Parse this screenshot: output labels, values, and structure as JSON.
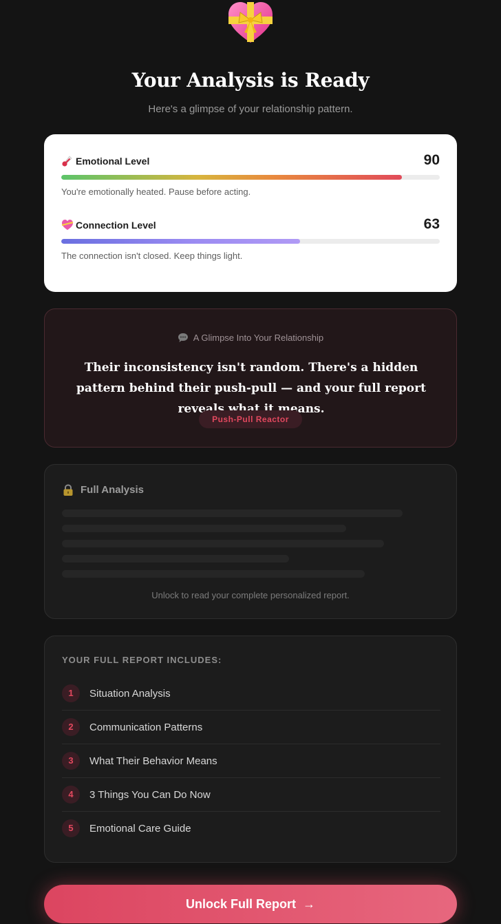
{
  "hero": {
    "icon": "heart-with-ribbon-icon",
    "title": "Your Analysis is Ready",
    "subtitle": "Here's a glimpse of your relationship pattern."
  },
  "meters": [
    {
      "icon": "thermometer-icon",
      "label": "Emotional Level",
      "value": "90",
      "fill_percent": 90,
      "description": "You're emotionally heated. Pause before acting."
    },
    {
      "icon": "heart-icon",
      "label": "Connection Level",
      "value": "63",
      "fill_percent": 63,
      "description": "The connection isn't closed. Keep things light."
    }
  ],
  "glimpse": {
    "icon": "speech-bubble-icon",
    "heading": "A Glimpse Into Your Relationship",
    "quote": "Their inconsistency isn't random. There's a hidden pattern behind their push-pull — and your full report reveals what it means.",
    "archetype": "Push-Pull Reactor"
  },
  "locked": {
    "icon": "lock-icon",
    "title": "Full Analysis",
    "note": "Unlock to read your complete personalized report."
  },
  "includes": {
    "heading": "YOUR FULL REPORT INCLUDES:",
    "items": [
      {
        "number": "1",
        "label": "Situation Analysis"
      },
      {
        "number": "2",
        "label": "Communication Patterns"
      },
      {
        "number": "3",
        "label": "What Their Behavior Means"
      },
      {
        "number": "4",
        "label": "3 Things You Can Do Now"
      },
      {
        "number": "5",
        "label": "Emotional Care Guide"
      }
    ]
  },
  "cta": {
    "label": "Unlock Full Report",
    "arrow": "→"
  },
  "colors": {
    "background": "#141414",
    "accent": "#e2485e",
    "card_light": "#ffffff",
    "card_dark": "#1c1c1c"
  }
}
